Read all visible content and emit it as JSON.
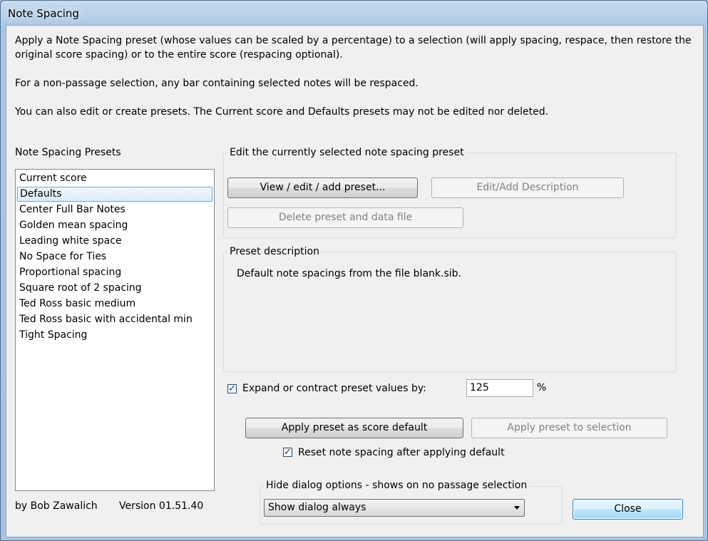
{
  "window": {
    "title": "Note Spacing"
  },
  "intro": {
    "line1": "Apply a Note Spacing preset (whose values can be scaled by a percentage) to a selection (will apply spacing, respace, then restore the",
    "line2": "original score spacing) or to the entire score (respacing optional).",
    "line3": "For a non-passage selection, any bar containing selected notes will be respaced.",
    "line4": "You can also edit or create presets. The Current score and Defaults presets may not be edited nor deleted."
  },
  "presets": {
    "label": "Note Spacing Presets",
    "selected_index": 1,
    "items": [
      {
        "label": "Current score"
      },
      {
        "label": "Defaults"
      },
      {
        "label": "Center Full Bar Notes"
      },
      {
        "label": "Golden mean spacing"
      },
      {
        "label": "Leading white space"
      },
      {
        "label": "No Space for Ties"
      },
      {
        "label": "Proportional spacing"
      },
      {
        "label": "Square root of 2 spacing"
      },
      {
        "label": "Ted Ross basic medium"
      },
      {
        "label": "Ted Ross basic with accidental min"
      },
      {
        "label": "Tight Spacing"
      }
    ]
  },
  "edit_group": {
    "label": "Edit the currently selected note spacing preset",
    "view_edit_add": "View / edit / add preset...",
    "edit_add_description": "Edit/Add Description",
    "delete_preset": "Delete preset and data file"
  },
  "description_group": {
    "label": "Preset description",
    "text": "Default note spacings from the file blank.sib."
  },
  "scale": {
    "checkbox_label": "Expand or contract preset values by:",
    "checked": true,
    "value": "125",
    "unit": "%"
  },
  "apply": {
    "score_default": "Apply preset as score default",
    "selection": "Apply preset to selection",
    "reset_label": "Reset note spacing after applying default",
    "reset_checked": true
  },
  "hide_group": {
    "label": "Hide dialog options - shows on no passage selection",
    "selected_option": "Show dialog always"
  },
  "footer": {
    "author": "by Bob Zawalich",
    "version": "Version 01.51.40",
    "close": "Close"
  },
  "colors": {
    "selection_border": "#7da2ce",
    "default_button_border": "#3c7fb1",
    "dialog_background": "#f0f0f0"
  }
}
